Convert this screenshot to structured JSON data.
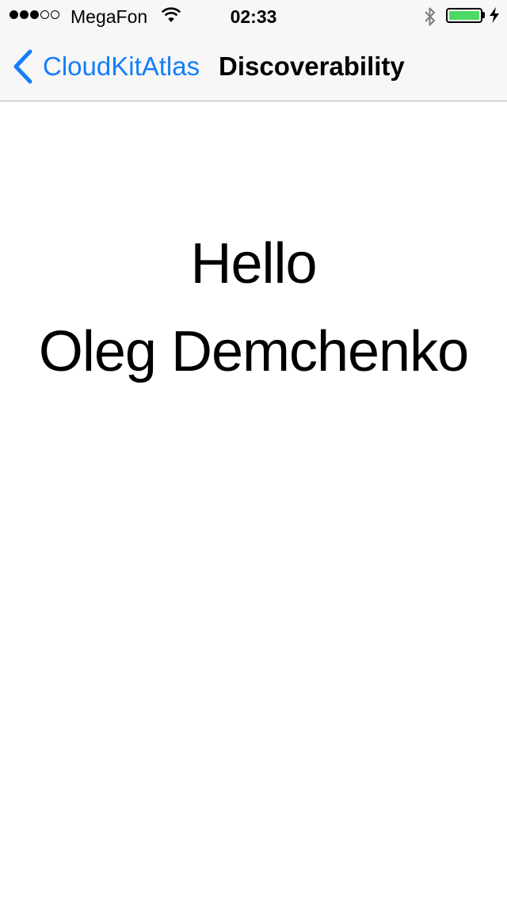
{
  "status_bar": {
    "carrier": "MegaFon",
    "time": "02:33",
    "signal_bars_filled": 3,
    "signal_bars_total": 5,
    "battery_level": 1.0,
    "battery_color": "#4cd964",
    "icons": [
      "signal-dots-icon",
      "wifi-icon",
      "bluetooth-icon",
      "battery-icon",
      "charging-bolt-icon"
    ]
  },
  "nav_bar": {
    "back_label": "CloudKitAtlas",
    "title": "Discoverability",
    "accent_color": "#147efb",
    "icons": [
      "chevron-left-icon"
    ]
  },
  "content": {
    "greeting": "Hello",
    "user_name": "Oleg Demchenko"
  }
}
